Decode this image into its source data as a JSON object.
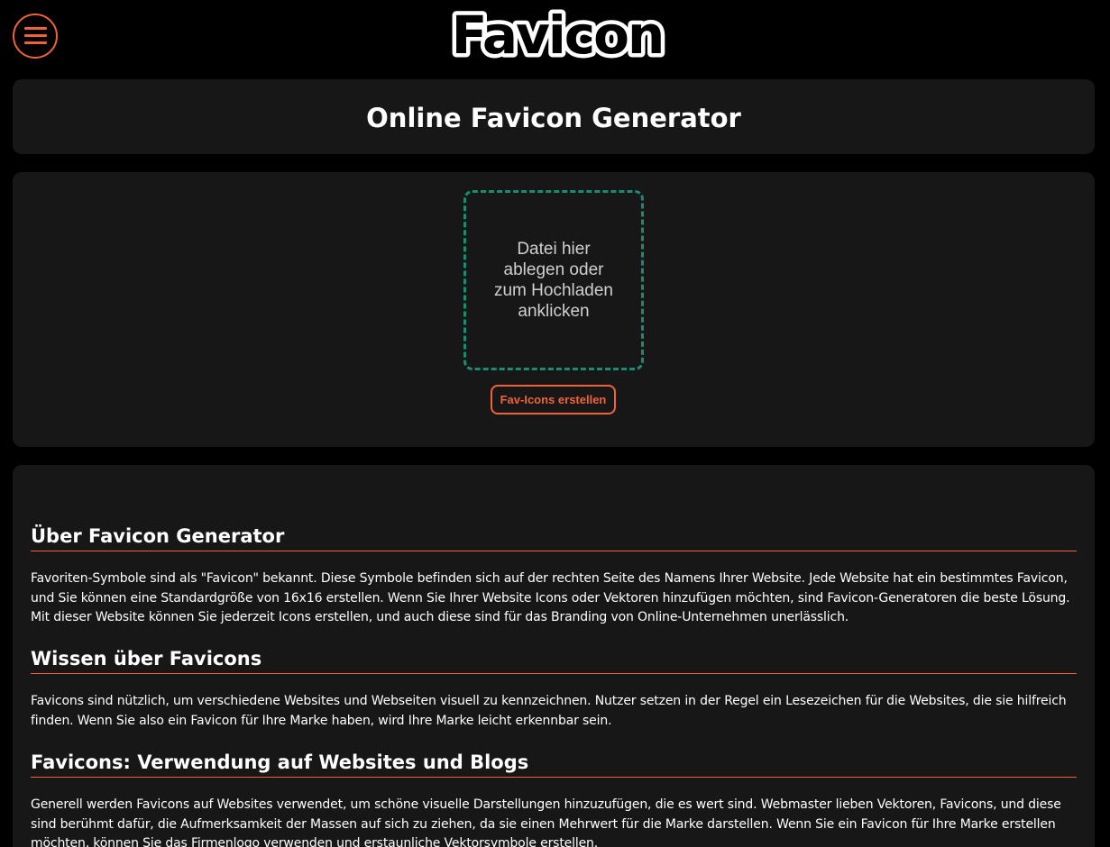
{
  "header": {
    "menu_icon": "hamburger-menu-icon",
    "logo_text": "Favicon"
  },
  "title_card": {
    "title": "Online Favicon Generator"
  },
  "upload": {
    "dropzone_text": "Datei hier ablegen oder zum Hochladen anklicken",
    "button_label": "Fav-Icons erstellen"
  },
  "content": {
    "sections": [
      {
        "heading": "Über Favicon Generator",
        "text": "Favoriten-Symbole sind als \"Favicon\" bekannt. Diese Symbole befinden sich auf der rechten Seite des Namens Ihrer Website. Jede Website hat ein bestimmtes Favicon, und Sie können eine Standardgröße von 16x16 erstellen. Wenn Sie Ihrer Website Icons oder Vektoren hinzufügen möchten, sind Favicon-Generatoren die beste Lösung. Mit dieser Website können Sie jederzeit Icons erstellen, und auch diese sind für das Branding von Online-Unternehmen unerlässlich."
      },
      {
        "heading": "Wissen über Favicons",
        "text": "Favicons sind nützlich, um verschiedene Websites und Webseiten visuell zu kennzeichnen. Nutzer setzen in der Regel ein Lesezeichen für die Websites, die sie hilfreich finden. Wenn Sie also ein Favicon für Ihre Marke haben, wird Ihre Marke leicht erkennbar sein."
      },
      {
        "heading": "Favicons: Verwendung auf Websites und Blogs",
        "text": "Generell werden Favicons auf Websites verwendet, um schöne visuelle Darstellungen hinzuzufügen, die es wert sind. Webmaster lieben Vektoren, Favicons, und diese sind berühmt dafür, die Aufmerksamkeit der Massen auf sich zu ziehen, da sie einen Mehrwert für die Marke darstellen. Wenn Sie ein Favicon für Ihre Marke erstellen möchten, können Sie das Firmenlogo verwenden und erstaunliche Vektorsymbole erstellen."
      }
    ]
  },
  "colors": {
    "background": "#000000",
    "card": "#171717",
    "accent": "#f0633a",
    "dropzone_border": "#1b8c72",
    "text": "#ffffff"
  }
}
